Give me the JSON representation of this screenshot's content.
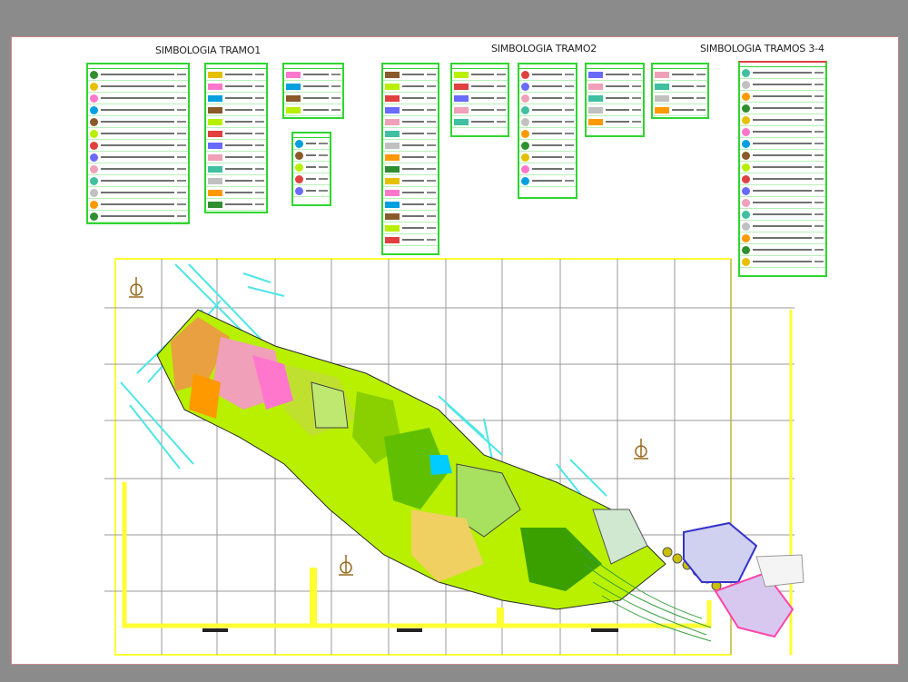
{
  "titles": {
    "tramo1": "SIMBOLOGIA TRAMO1",
    "tramo2": "SIMBOLOGIA TRAMO2",
    "tramos34": "SIMBOLOGIA TRAMOS 3-4"
  },
  "colors": {
    "background": "#8b8b8b",
    "sheet": "#ffffff",
    "legend_border": "#2fd62f",
    "frame": "#ffff33",
    "grid": "#9a9a9a",
    "roads": "#4ee6e6",
    "plan_green": "#b8f000",
    "plan_pink": "#f0a0b8",
    "water": "#00ccff"
  },
  "icons": [
    "north-arrow-icon"
  ]
}
